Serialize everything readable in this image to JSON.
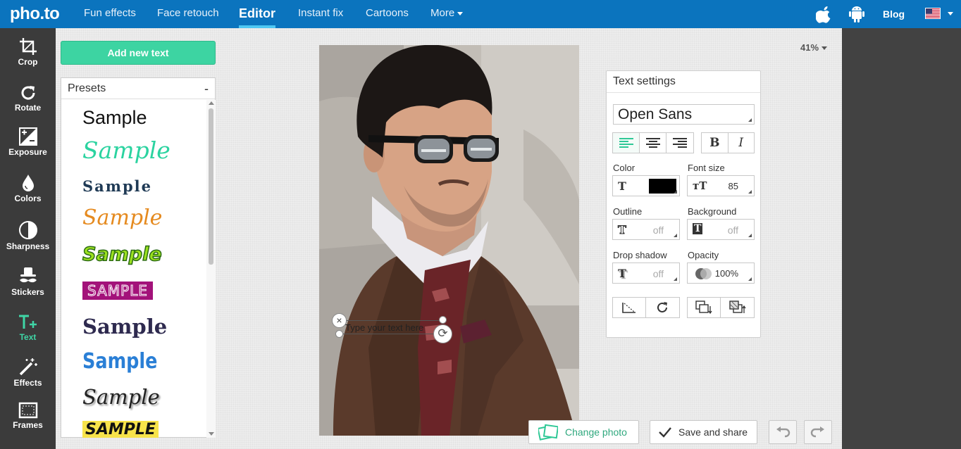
{
  "brand": {
    "logo": "pho.to"
  },
  "nav": {
    "items": [
      "Fun effects",
      "Face retouch",
      "Editor",
      "Instant fix",
      "Cartoons"
    ],
    "more": "More",
    "blog": "Blog"
  },
  "icons": {
    "apple": "apple-icon",
    "android": "android-icon",
    "flag": "us-flag-icon"
  },
  "tools": [
    {
      "label": "Crop",
      "icon": "crop-icon"
    },
    {
      "label": "Rotate",
      "icon": "rotate-icon"
    },
    {
      "label": "Exposure",
      "icon": "exposure-icon"
    },
    {
      "label": "Colors",
      "icon": "drop-icon"
    },
    {
      "label": "Sharpness",
      "icon": "sharpness-icon"
    },
    {
      "label": "Stickers",
      "icon": "hat-mustache-icon"
    },
    {
      "label": "Text",
      "icon": "text-plus-icon",
      "active": true
    },
    {
      "label": "Effects",
      "icon": "magic-wand-icon"
    },
    {
      "label": "Frames",
      "icon": "frame-icon"
    }
  ],
  "add_text_button": "Add new text",
  "presets": {
    "title": "Presets",
    "collapse": "-",
    "items": [
      "Sample",
      "Sample",
      "Sample",
      "Sample",
      "Sample",
      "SAMPLE",
      "Sample",
      "Sample",
      "Sample",
      "SAMPLE"
    ]
  },
  "canvas": {
    "textbox_placeholder": "Type your text here",
    "zoom": "41%"
  },
  "text_settings": {
    "title": "Text settings",
    "font": "Open Sans",
    "color_label": "Color",
    "color_value": "#000000",
    "font_size_label": "Font size",
    "font_size": "85",
    "outline_label": "Outline",
    "outline_value": "off",
    "background_label": "Background",
    "background_value": "off",
    "drop_shadow_label": "Drop shadow",
    "drop_shadow_value": "off",
    "opacity_label": "Opacity",
    "opacity_value": "100%",
    "bold": "B",
    "italic": "I"
  },
  "actions": {
    "change_photo": "Change photo",
    "save_and_share": "Save and share"
  },
  "colors": {
    "topbar": "#0b74be",
    "accent": "#3dd4a2",
    "sidebar": "#3b3b3b"
  }
}
